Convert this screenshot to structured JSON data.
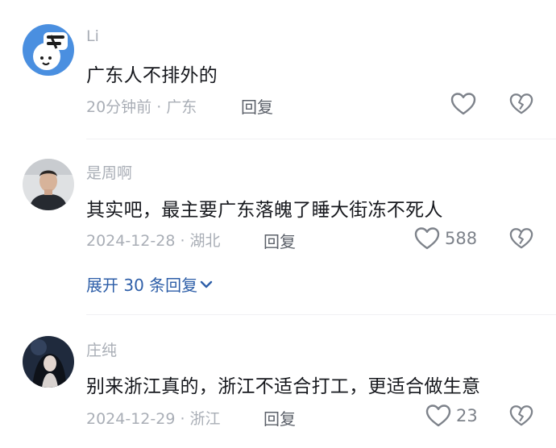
{
  "comments": [
    {
      "username": "Li",
      "text": "广东人不排外的",
      "meta": "20分钟前 · 广东",
      "reply_label": "回复",
      "like_count": "",
      "like_icon": "heart-outline-icon",
      "dislike_icon": "broken-heart-icon"
    },
    {
      "username": "是周啊",
      "text": "其实吧，最主要广东落魄了睡大街冻不死人",
      "meta": "2024-12-28 · 湖北",
      "reply_label": "回复",
      "like_count": "588",
      "like_icon": "heart-outline-icon",
      "dislike_icon": "broken-heart-icon",
      "expand_replies": "展开 30 条回复"
    },
    {
      "username": "庄纯",
      "text": "别来浙江真的，浙江不适合打工，更适合做生意",
      "meta": "2024-12-29 · 浙江",
      "reply_label": "回复",
      "like_count": "23",
      "like_icon": "heart-outline-icon",
      "dislike_icon": "broken-heart-icon"
    }
  ],
  "colors": {
    "text_primary": "#16181d",
    "text_secondary": "#a9aeb6",
    "link_blue": "#2d5ea8",
    "icon_gray": "#7d828a"
  }
}
